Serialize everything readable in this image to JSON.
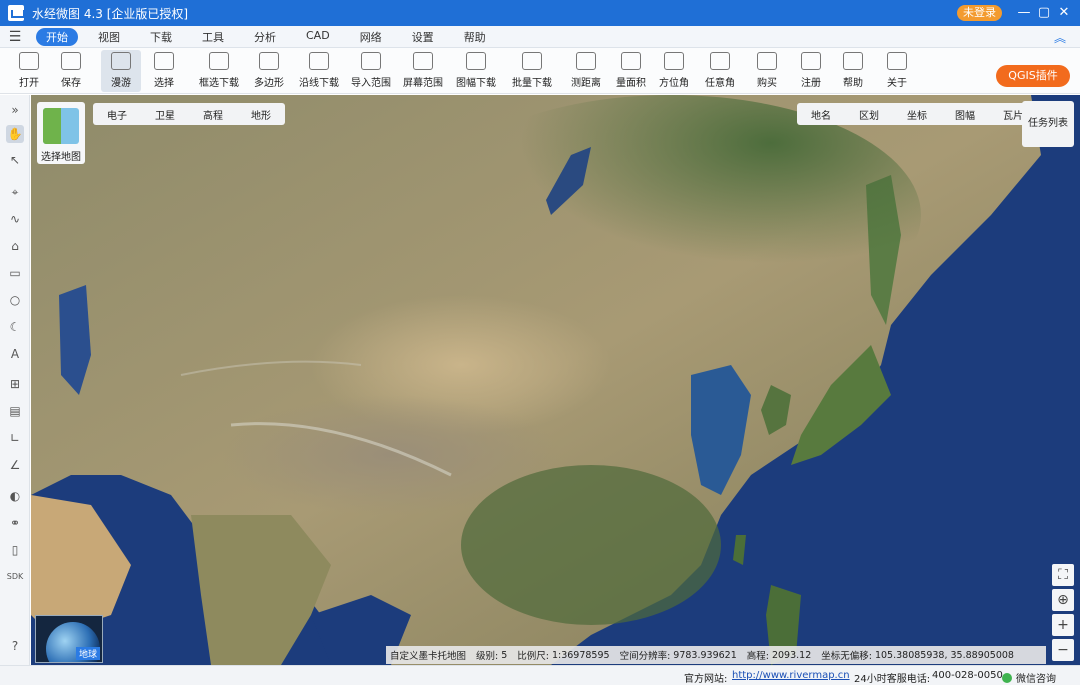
{
  "window": {
    "title": "水经微图 4.3 [企业版已授权]",
    "login_badge": "未登录",
    "min_symbol": "—",
    "max_symbol": "▢",
    "close_symbol": "✕"
  },
  "menu": {
    "hamburger": "☰",
    "tabs": [
      "开始",
      "视图",
      "下载",
      "工具",
      "分析",
      "CAD",
      "网络",
      "设置",
      "帮助"
    ],
    "active_index": 0,
    "collapse": "︽"
  },
  "toolbar": {
    "items": [
      {
        "label": "打开",
        "icon": "folder-icon"
      },
      {
        "label": "保存",
        "icon": "save-icon"
      },
      {
        "label": "漫游",
        "icon": "hand-icon"
      },
      {
        "label": "选择",
        "icon": "cursor-icon"
      },
      {
        "label": "框选下载",
        "icon": "box-download-icon"
      },
      {
        "label": "多边形",
        "icon": "polygon-icon"
      },
      {
        "label": "沿线下载",
        "icon": "line-download-icon"
      },
      {
        "label": "导入范围",
        "icon": "import-icon"
      },
      {
        "label": "屏幕范围",
        "icon": "screen-icon"
      },
      {
        "label": "图幅下载",
        "icon": "grid-icon"
      },
      {
        "label": "批量下载",
        "icon": "batch-icon"
      },
      {
        "label": "测距离",
        "icon": "ruler-icon"
      },
      {
        "label": "量面积",
        "icon": "area-icon"
      },
      {
        "label": "方位角",
        "icon": "azimuth-icon"
      },
      {
        "label": "任意角",
        "icon": "angle-icon"
      },
      {
        "label": "购买",
        "icon": "cart-icon"
      },
      {
        "label": "注册",
        "icon": "lock-icon"
      },
      {
        "label": "帮助",
        "icon": "help-icon"
      },
      {
        "label": "关于",
        "icon": "info-icon"
      }
    ],
    "active_index": 2,
    "qgis_button": "QGIS插件"
  },
  "map": {
    "map_selector_label": "选择地图",
    "map_types": [
      "电子",
      "卫星",
      "高程",
      "地形"
    ],
    "overlays": [
      "地名",
      "区划",
      "坐标",
      "图幅",
      "瓦片"
    ],
    "task_list": "任务列表",
    "globe_label": "地球",
    "controls": {
      "fullscreen": "⛶",
      "locate": "⊕",
      "zoom_in": "+",
      "zoom_out": "−"
    }
  },
  "status": {
    "projection": "自定义墨卡托地图",
    "level_label": "级别:",
    "level": "5",
    "scale_label": "比例尺:",
    "scale": "1:36978595",
    "resolution_label": "空间分辨率:",
    "resolution": "9783.939621",
    "elevation_label": "高程:",
    "elevation": "2093.12",
    "offset_label": "坐标无偏移:",
    "coords": "105.38085938, 35.88905008"
  },
  "footer": {
    "website_label": "官方网站:",
    "website": "http://www.rivermap.cn",
    "hotline_label": "24小时客服电话:",
    "hotline": "400-028-0050",
    "wechat": "微信咨询"
  },
  "colors": {
    "titlebar": "#1f6fd6",
    "accent": "#2b7be4",
    "qgis": "#f26b1d",
    "login_badge": "#f39b2f"
  }
}
